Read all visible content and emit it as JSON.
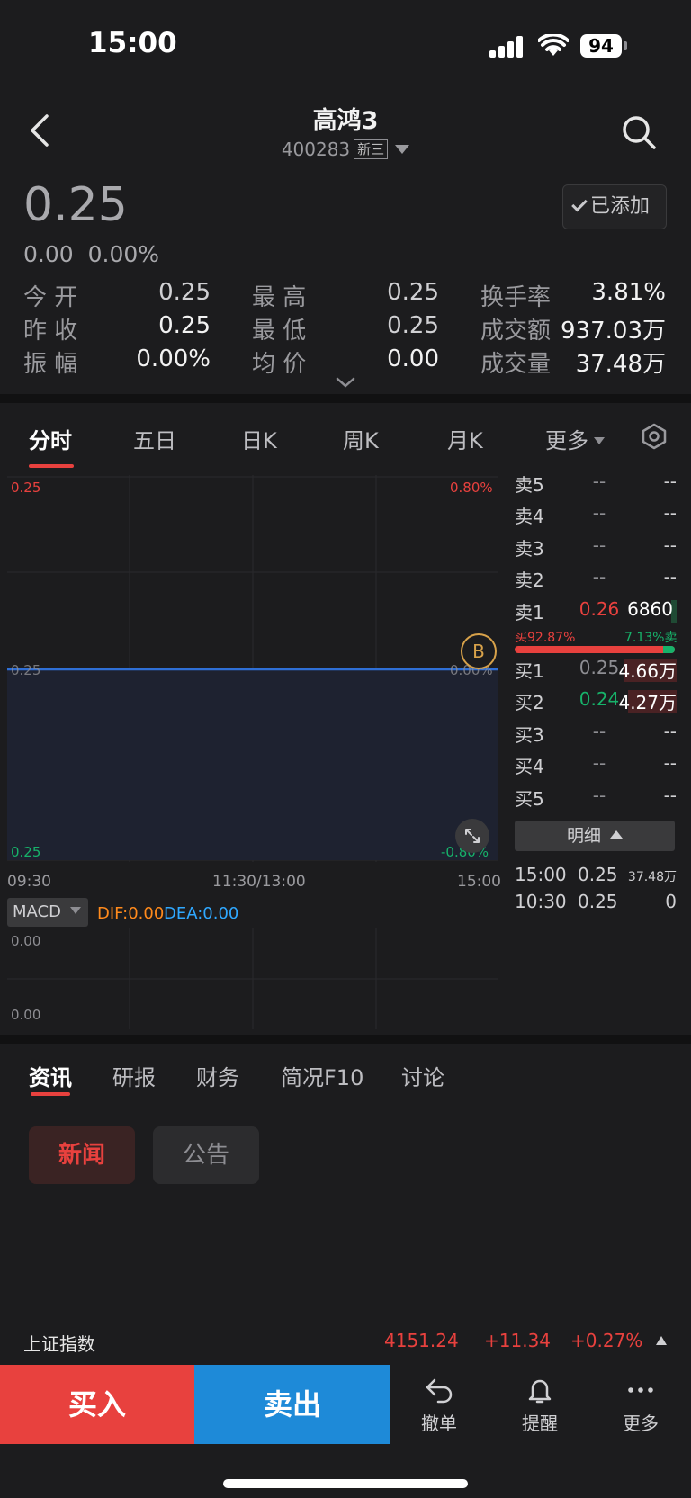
{
  "status": {
    "time": "15:00",
    "battery": "94"
  },
  "header": {
    "title": "高鸿3",
    "code": "400283",
    "market_tag": "新三"
  },
  "price": {
    "last": "0.25",
    "change": "0.00",
    "change_pct": "0.00%"
  },
  "watch_button": "已添加",
  "stats": [
    {
      "label": "今 开",
      "value": "0.25"
    },
    {
      "label": "昨 收",
      "value": "0.25"
    },
    {
      "label": "振 幅",
      "value": "0.00%"
    },
    {
      "label": "最 高",
      "value": "0.25"
    },
    {
      "label": "最 低",
      "value": "0.25"
    },
    {
      "label": "均 价",
      "value": "0.00"
    },
    {
      "label": "换手率",
      "value": "3.81%"
    },
    {
      "label": "成交额",
      "value": "937.03万"
    },
    {
      "label": "成交量",
      "value": "37.48万"
    }
  ],
  "chart_tabs": [
    "分时",
    "五日",
    "日K",
    "周K",
    "月K",
    "更多"
  ],
  "chart": {
    "y_top": "0.25",
    "pct_top": "0.80%",
    "y_mid": "0.25",
    "pct_mid": "0.00%",
    "y_bot": "0.25",
    "pct_bot": "-0.80%",
    "t_start": "09:30",
    "t_mid": "11:30/13:00",
    "t_end": "15:00",
    "marker": "B"
  },
  "chart_data": {
    "type": "line",
    "x": [
      "09:30",
      "11:30/13:00",
      "15:00"
    ],
    "series": [
      {
        "values": [
          0.25,
          0.25,
          0.25
        ]
      }
    ],
    "ylim": [
      0.25,
      0.25
    ]
  },
  "macd": {
    "selector": "MACD",
    "dif": "DIF:0.00",
    "dea": "DEA:0.00",
    "y_top": "0.00",
    "y_bot": "0.00"
  },
  "orderbook": {
    "asks": [
      {
        "label": "卖5",
        "price": "--",
        "vol": "--"
      },
      {
        "label": "卖4",
        "price": "--",
        "vol": "--"
      },
      {
        "label": "卖3",
        "price": "--",
        "vol": "--"
      },
      {
        "label": "卖2",
        "price": "--",
        "vol": "--"
      },
      {
        "label": "卖1",
        "price": "0.26",
        "vol": "6860"
      }
    ],
    "buy_ratio": "买92.87%",
    "sell_ratio": "7.13%卖",
    "bids": [
      {
        "label": "买1",
        "price": "0.25",
        "vol": "4.66万"
      },
      {
        "label": "买2",
        "price": "0.24",
        "vol": "4.27万"
      },
      {
        "label": "买3",
        "price": "--",
        "vol": "--"
      },
      {
        "label": "买4",
        "price": "--",
        "vol": "--"
      },
      {
        "label": "买5",
        "price": "--",
        "vol": "--"
      }
    ],
    "detail_label": "明细",
    "ticks": [
      {
        "time": "15:00",
        "price": "0.25",
        "vol": "37.48万"
      },
      {
        "time": "10:30",
        "price": "0.25",
        "vol": "0"
      }
    ]
  },
  "news_tabs": [
    "资讯",
    "研报",
    "财务",
    "简况F10",
    "讨论"
  ],
  "news_pills": [
    "新闻",
    "公告"
  ],
  "index_ticker": {
    "name": "上证指数",
    "value": "4151.24",
    "change": "+11.34",
    "change_pct": "+0.27%"
  },
  "actions": {
    "buy": "买入",
    "sell": "卖出",
    "cancel": "撤单",
    "alert": "提醒",
    "more": "更多"
  },
  "colors": {
    "up": "#e8413e",
    "down": "#17b26a",
    "sell_btn": "#1e8ad8",
    "background": "#1c1c1e"
  }
}
